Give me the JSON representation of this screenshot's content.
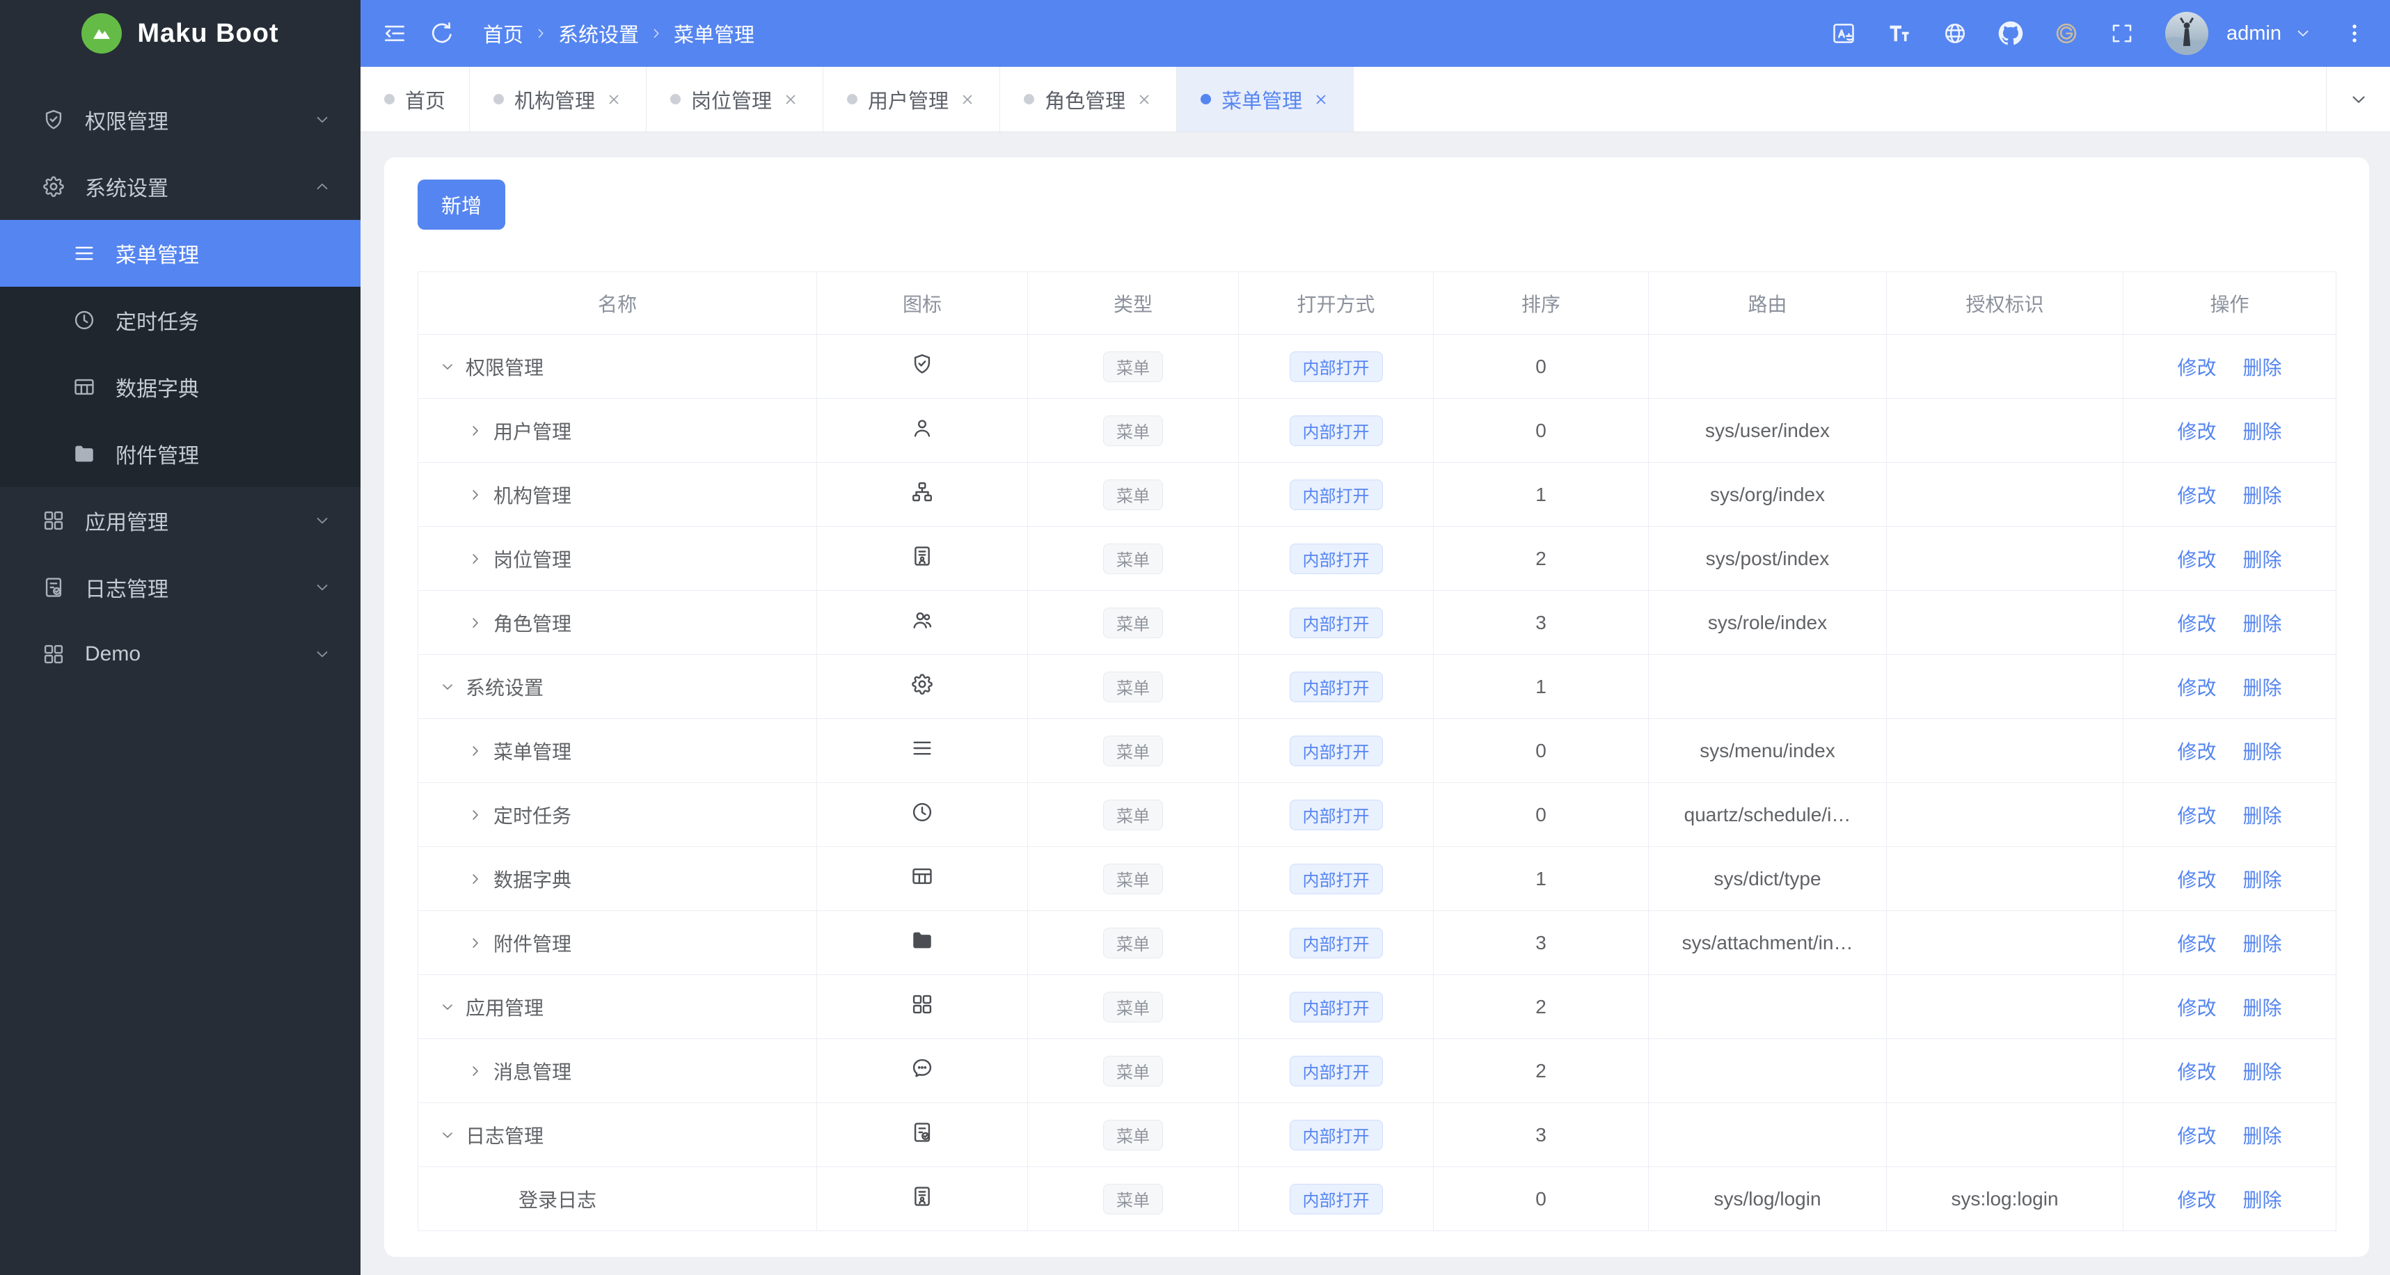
{
  "app": {
    "title": "Maku Boot"
  },
  "colors": {
    "accent": "#5585f0",
    "sidebar_bg": "#262d36",
    "submenu_bg": "#20262e",
    "logo_green": "#64bc47",
    "content_bg": "#eef0f4",
    "tag_blue_bg": "#e9f0fe",
    "tag_info_text": "#8f959e"
  },
  "sidebar": {
    "items": [
      {
        "label": "权限管理",
        "icon": "shield-check-icon",
        "expanded": false
      },
      {
        "label": "系统设置",
        "icon": "gear-icon",
        "expanded": true,
        "children": [
          {
            "label": "菜单管理",
            "icon": "menu-lines-icon",
            "active": true
          },
          {
            "label": "定时任务",
            "icon": "clock-icon",
            "active": false
          },
          {
            "label": "数据字典",
            "icon": "table-grid-icon",
            "active": false
          },
          {
            "label": "附件管理",
            "icon": "folder-filled-icon",
            "active": false
          }
        ]
      },
      {
        "label": "应用管理",
        "icon": "grid-icon",
        "expanded": false
      },
      {
        "label": "日志管理",
        "icon": "doc-check-icon",
        "expanded": false
      },
      {
        "label": "Demo",
        "icon": "grid-icon",
        "expanded": false
      }
    ]
  },
  "header": {
    "left_icons": [
      "collapse-icon",
      "refresh-icon"
    ],
    "breadcrumb": [
      "首页",
      "系统设置",
      "菜单管理"
    ],
    "right_icons": [
      "translate-icon",
      "font-size-icon",
      "globe-icon",
      "github-icon",
      "gitee-icon",
      "fullscreen-icon"
    ],
    "user": "admin"
  },
  "tabs": [
    {
      "label": "首页",
      "closable": false,
      "active": false
    },
    {
      "label": "机构管理",
      "closable": true,
      "active": false
    },
    {
      "label": "岗位管理",
      "closable": true,
      "active": false
    },
    {
      "label": "用户管理",
      "closable": true,
      "active": false
    },
    {
      "label": "角色管理",
      "closable": true,
      "active": false
    },
    {
      "label": "菜单管理",
      "closable": true,
      "active": true
    }
  ],
  "toolbar": {
    "add_label": "新增"
  },
  "table": {
    "columns": [
      "名称",
      "图标",
      "类型",
      "打开方式",
      "排序",
      "路由",
      "授权标识",
      "操作"
    ],
    "type_tag": "菜单",
    "open_tag": "内部打开",
    "actions": {
      "edit": "修改",
      "delete": "删除"
    },
    "rows": [
      {
        "name": "权限管理",
        "level": 0,
        "expand": "down",
        "icon": "shield-check-icon",
        "sort": "0",
        "route": "",
        "auth": ""
      },
      {
        "name": "用户管理",
        "level": 1,
        "expand": "right",
        "icon": "user-icon",
        "sort": "0",
        "route": "sys/user/index",
        "auth": ""
      },
      {
        "name": "机构管理",
        "level": 1,
        "expand": "right",
        "icon": "org-tree-icon",
        "sort": "1",
        "route": "sys/org/index",
        "auth": ""
      },
      {
        "name": "岗位管理",
        "level": 1,
        "expand": "right",
        "icon": "id-card-icon",
        "sort": "2",
        "route": "sys/post/index",
        "auth": ""
      },
      {
        "name": "角色管理",
        "level": 1,
        "expand": "right",
        "icon": "users-icon",
        "sort": "3",
        "route": "sys/role/index",
        "auth": ""
      },
      {
        "name": "系统设置",
        "level": 0,
        "expand": "down",
        "icon": "gear-icon",
        "sort": "1",
        "route": "",
        "auth": ""
      },
      {
        "name": "菜单管理",
        "level": 1,
        "expand": "right",
        "icon": "menu-lines-icon",
        "sort": "0",
        "route": "sys/menu/index",
        "auth": ""
      },
      {
        "name": "定时任务",
        "level": 1,
        "expand": "right",
        "icon": "clock-icon",
        "sort": "0",
        "route": "quartz/schedule/i…",
        "auth": ""
      },
      {
        "name": "数据字典",
        "level": 1,
        "expand": "right",
        "icon": "table-grid-icon",
        "sort": "1",
        "route": "sys/dict/type",
        "auth": ""
      },
      {
        "name": "附件管理",
        "level": 1,
        "expand": "right",
        "icon": "folder-filled-icon",
        "sort": "3",
        "route": "sys/attachment/in…",
        "auth": ""
      },
      {
        "name": "应用管理",
        "level": 0,
        "expand": "down",
        "icon": "grid-icon",
        "sort": "2",
        "route": "",
        "auth": ""
      },
      {
        "name": "消息管理",
        "level": 1,
        "expand": "right",
        "icon": "chat-bubble-icon",
        "sort": "2",
        "route": "",
        "auth": ""
      },
      {
        "name": "日志管理",
        "level": 0,
        "expand": "down",
        "icon": "doc-check-icon",
        "sort": "3",
        "route": "",
        "auth": ""
      },
      {
        "name": "登录日志",
        "level": 2,
        "expand": "none",
        "icon": "id-card-icon",
        "sort": "0",
        "route": "sys/log/login",
        "auth": "sys:log:login"
      }
    ]
  }
}
